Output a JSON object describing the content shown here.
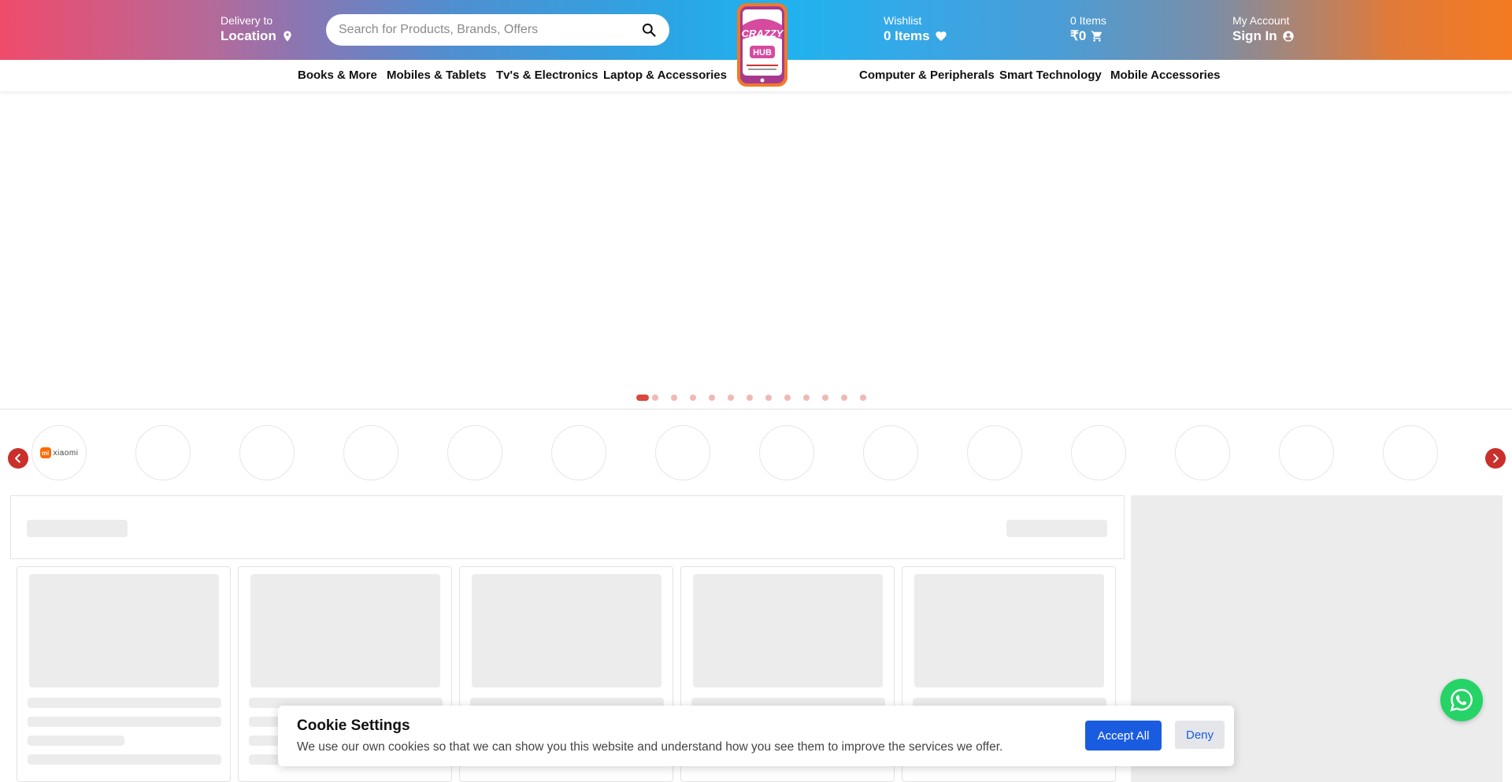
{
  "header": {
    "delivery": {
      "label": "Delivery to",
      "value": "Location",
      "icon": "location-pin-icon"
    },
    "search": {
      "placeholder": "Search for Products, Brands, Offers",
      "icon": "search-icon"
    },
    "logo": {
      "name": "Crazzy Hub",
      "icon": "crazzy-hub-logo"
    },
    "wishlist": {
      "label": "Wishlist",
      "value": "0 Items",
      "icon": "heart-icon"
    },
    "cart": {
      "label": "0 Items",
      "value": "₹0",
      "icon": "cart-icon"
    },
    "account": {
      "label": "My Account",
      "value": "Sign In",
      "icon": "user-icon"
    }
  },
  "nav": {
    "items": [
      {
        "label": "Books & More"
      },
      {
        "label": "Mobiles & Tablets"
      },
      {
        "label": "Tv's & Electronics"
      },
      {
        "label": "Laptop & Accessories"
      },
      {
        "label": "Computer & Peripherals"
      },
      {
        "label": "Smart Technology"
      },
      {
        "label": "Mobile Accessories"
      }
    ]
  },
  "carousel": {
    "slide_count": 13,
    "active_index": 0
  },
  "brands": {
    "first_brand": {
      "badge": "mi",
      "name": "xiaomi"
    },
    "circle_count": 14,
    "prev_icon": "chevron-left-icon",
    "next_icon": "chevron-right-icon"
  },
  "cookie": {
    "title": "Cookie Settings",
    "text": "We use our own cookies so that we can show you this website and understand how you see them to improve the services we offer.",
    "accept": "Accept All",
    "deny": "Deny"
  },
  "colors": {
    "accent_red": "#d9473d",
    "accept_blue": "#1a5ce0",
    "whatsapp_green": "#25d366"
  },
  "whatsapp": {
    "icon": "whatsapp-icon"
  }
}
